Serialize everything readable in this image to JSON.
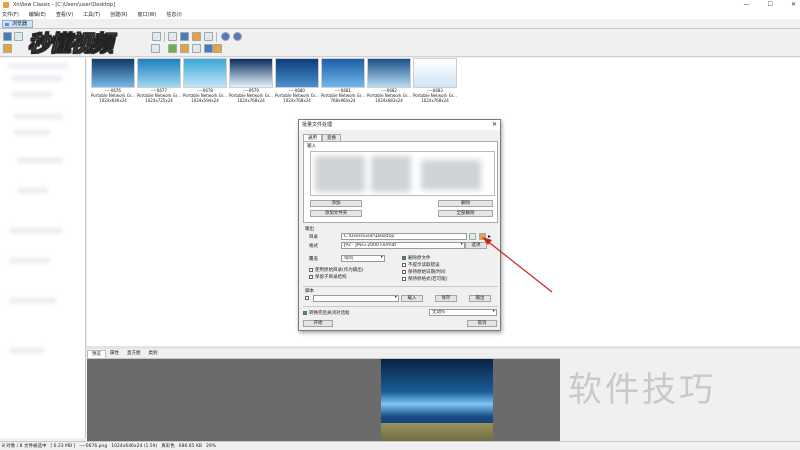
{
  "window": {
    "title": "XnView Classic - [C:\\Users\\user\\Desktop]",
    "controls": [
      "—",
      "☐",
      "✕"
    ]
  },
  "menu": [
    "文件(F)",
    "编辑(E)",
    "查看(V)",
    "工具(T)",
    "创建(R)",
    "窗口(W)",
    "信息(I)"
  ],
  "tab_label": "浏览器",
  "logo_text": "秒懂视频",
  "thumbnails": [
    {
      "name": "----0676",
      "type": "Portable Network Gr...",
      "dims": "1024x646x24",
      "color_a": "#0f3a66",
      "color_b": "#77b7e6"
    },
    {
      "name": "----0677",
      "type": "Portable Network Gr...",
      "dims": "1024x725x24",
      "color_a": "#1e7fbf",
      "color_b": "#9fd7f3"
    },
    {
      "name": "----0678",
      "type": "Portable Network Gr...",
      "dims": "1024x594x24",
      "color_a": "#3aa7d8",
      "color_b": "#bfe7f6"
    },
    {
      "name": "----0679",
      "type": "Portable Network Gr...",
      "dims": "1024x768x24",
      "color_a": "#0a2c5c",
      "color_b": "#e6f3ff"
    },
    {
      "name": "----0680",
      "type": "Portable Network Gr...",
      "dims": "1024x768x24",
      "color_a": "#0d3d7a",
      "color_b": "#4b8fd0"
    },
    {
      "name": "----0681",
      "type": "Portable Network Gr...",
      "dims": "768x960x24",
      "color_a": "#1f5ea8",
      "color_b": "#6fb7ec"
    },
    {
      "name": "----0682",
      "type": "Portable Network Gr...",
      "dims": "1024x683x24",
      "color_a": "#1a4f86",
      "color_b": "#b5dcf4"
    },
    {
      "name": "----0683",
      "type": "Portable Network Gr...",
      "dims": "1024x768x24",
      "color_a": "#ffffff",
      "color_b": "#cfe6f6"
    }
  ],
  "dialog": {
    "title": "批量文件处理",
    "close": "✕",
    "tabs": [
      "通用",
      "变换"
    ],
    "input_label": "输入",
    "add_button": "添加",
    "add_folder_button": "添加文件夹",
    "delete_button": "删除",
    "delete_all_button": "全部删除",
    "output_label": "输出",
    "dir_label": "目录",
    "dir_value": "C:\\Users\\user\\Desktop",
    "format_label": "格式",
    "format_value": "JP2 - JPEG-2000 Format",
    "options_button": "选项",
    "overwrite_label": "覆盖",
    "overwrite_value": "询问",
    "use_source_dir": "使用原始目录(作为输出)",
    "keep_subdir": "保留子目录结构",
    "delete_source": "删除原文件",
    "no_error_prompt": "不提示读取错误",
    "keep_date": "保持原始日期/时间",
    "keep_format": "保持原格式(若可能)",
    "script_label": "脚本",
    "load_button": "载入",
    "save_button": "保存",
    "export_button": "输出",
    "close_on_done": "转换完后关闭对话框",
    "action_value": "无动作",
    "start_button": "开始",
    "cancel_button": "取消"
  },
  "preview_tabs": [
    "预览",
    "属性",
    "直方图",
    "类别"
  ],
  "watermark": "软件技巧",
  "status": {
    "count": "8 对象 / 8 文件被选中",
    "size": "[ 6.23 MB ]",
    "file": "----0676.png",
    "dims": "1024x646x24 (1.59)",
    "filesize": "真彩色",
    "kb": "686.65 KB",
    "zoom": "29%"
  },
  "colors": {
    "accent": "#4a7ab8",
    "arrow": "#cc2222"
  }
}
